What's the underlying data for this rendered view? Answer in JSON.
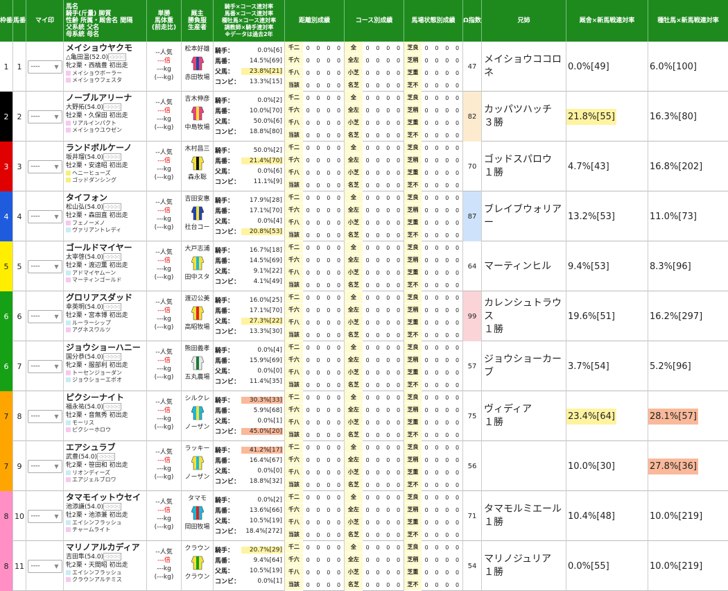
{
  "headers": {
    "waku": "枠番",
    "umaban": "馬番",
    "mark": "マイ印",
    "horse": [
      "馬名",
      "騎手(斤量) 脚質",
      "性齢 所属・厩舎名 間隔",
      "父系統 父名",
      "母系統 母名"
    ],
    "odds": [
      "単勝",
      "馬体重",
      "(前走比)"
    ],
    "owner": [
      "厩主",
      "勝負服",
      "生産者"
    ],
    "stats": [
      "騎手×コース連対率",
      "馬番×コース連対率",
      "種牡馬×コース連対率",
      "調教師×騎手連対率",
      "※データは過去2年"
    ],
    "dist": "距離別成績",
    "course": "コース別成績",
    "baba": "馬場状態別成績",
    "omega": "Ω指数",
    "sibling": "兄姉",
    "kyusha": "厩舎×新馬戦連対率",
    "sire": "種牡馬×新馬戦連対率"
  },
  "labels": {
    "stats": [
      "騎手：",
      "馬番：",
      "父馬：",
      "コンビ："
    ],
    "dist": [
      "千二",
      "千六",
      "千八",
      "当該"
    ],
    "course": [
      "全",
      "全左",
      "小芝",
      "名芝"
    ],
    "baba": [
      "芝良",
      "芝稍",
      "芝重",
      "芝不"
    ],
    "zero": "0",
    "mark_default": "----",
    "ninki": "--人気",
    "bai": "---倍",
    "kg": "---kg",
    "kg2": "(---kg)"
  },
  "colors": {
    "header": "#1e8a1e",
    "yellow": "#fff3a0",
    "orange": "#f9b99a",
    "blue": "#cfe2fb",
    "pink": "#fbd4d8",
    "peach": "#fdebd0"
  },
  "horses": [
    {
      "waku": "1",
      "wakuColor": "#ffffff",
      "wakuText": "#222",
      "umaban": "1",
      "name": "メイショウヤクモ",
      "jockey": "△亀田温(52.0)",
      "info": "牝2栗・西橋豊 初出走",
      "sire": "メイショウボーラー",
      "dam": "メイショウフェスタ",
      "sireColor": "#f6c8f0",
      "damColor": "#f6c8f0",
      "owner": "松本好雄",
      "breeder": "赤田牧場",
      "silk": [
        "#e8437a",
        "#1a49a8"
      ],
      "stats": [
        "0.0%[6]",
        "14.5%[69]",
        "23.8%[21]",
        "13.3%[15]"
      ],
      "hl": [
        null,
        null,
        "yellow",
        null
      ],
      "omega": "47",
      "omegaBg": null,
      "sibling": "メイショウココロネ",
      "sibWins": "",
      "kyusha": "0.0%[49]",
      "kyushaHl": null,
      "sireRate": "6.0%[100]",
      "sireHl": null
    },
    {
      "waku": "2",
      "wakuColor": "#000000",
      "wakuText": "#fff",
      "umaban": "2",
      "name": "ノーブルアリーナ",
      "jockey": "大野拓(54.0)",
      "info": "牡2栗・久保田 初出走",
      "sire": "リアルインパクト",
      "dam": "メイショウユウゼン",
      "sireColor": "#f6c8f0",
      "damColor": "#f6c8f0",
      "owner": "吉木伸彦",
      "breeder": "中島牧場",
      "silk": [
        "#e8437a",
        "#f3e23a"
      ],
      "stats": [
        "0.0%[2]",
        "10.0%[70]",
        "50.0%[6]",
        "18.8%[80]"
      ],
      "hl": [
        null,
        null,
        null,
        null
      ],
      "omega": "82",
      "omegaBg": "peach",
      "sibling": "カッパツハッチ",
      "sibWins": "３勝",
      "kyusha": "21.8%[55]",
      "kyushaHl": "yellow",
      "sireRate": "16.3%[80]",
      "sireHl": null
    },
    {
      "waku": "3",
      "wakuColor": "#e00000",
      "wakuText": "#fff",
      "umaban": "3",
      "name": "ランドボルケーノ",
      "jockey": "坂井瑠(54.0)",
      "info": "牡2栗・安達昭 初出走",
      "sire": "ヘニーヒューズ",
      "dam": "ゴッドダンシング",
      "sireColor": "#f6f07a",
      "damColor": "#f6f07a",
      "owner": "木村昌三",
      "breeder": "森永聡",
      "silk": [
        "#f3e23a",
        "#111111"
      ],
      "stats": [
        "50.0%[2]",
        "21.4%[70]",
        "0.0%[6]",
        "11.1%[9]"
      ],
      "hl": [
        null,
        "yellow",
        null,
        null
      ],
      "omega": "70",
      "omegaBg": null,
      "sibling": "ゴッドスパロウ",
      "sibWins": "１勝",
      "kyusha": "4.7%[43]",
      "kyushaHl": null,
      "sireRate": "16.8%[202]",
      "sireHl": null
    },
    {
      "waku": "4",
      "wakuColor": "#1f5cdd",
      "wakuText": "#fff",
      "umaban": "4",
      "name": "タイフォン",
      "jockey": "松山弘(54.0)",
      "info": "牡2栗・森田直 初出走",
      "sire": "フェノーメノ",
      "dam": "ヴァリアントレディ",
      "sireColor": "#f6c8f0",
      "damColor": "#c8ecf6",
      "owner": "吉田安惠",
      "breeder": "社台コー",
      "silk": [
        "#2244aa",
        "#f3e23a"
      ],
      "stats": [
        "17.9%[28]",
        "17.1%[70]",
        "0.0%[4]",
        "20.8%[53]"
      ],
      "hl": [
        null,
        null,
        null,
        "yellow"
      ],
      "omega": "87",
      "omegaBg": "blue",
      "sibling": "ブレイブウォリアー",
      "sibWins": "",
      "kyusha": "13.2%[53]",
      "kyushaHl": null,
      "sireRate": "11.0%[73]",
      "sireHl": null
    },
    {
      "waku": "5",
      "wakuColor": "#ffee00",
      "wakuText": "#222",
      "umaban": "5",
      "name": "ゴールドマイヤー",
      "jockey": "太宰啓(54.0)",
      "info": "牡2栗・渡辺薫 初出走",
      "sire": "アドマイヤムーン",
      "dam": "マーティンゴールド",
      "sireColor": "#c8ecf6",
      "damColor": "#f6c8f0",
      "owner": "大戸志浦",
      "breeder": "田中スタ",
      "silk": [
        "#f3e23a",
        "#1bb8d8"
      ],
      "stats": [
        "16.7%[18]",
        "14.5%[69]",
        "9.1%[22]",
        "4.1%[49]"
      ],
      "hl": [
        null,
        null,
        null,
        null
      ],
      "omega": "64",
      "omegaBg": null,
      "sibling": "マーティンヒル",
      "sibWins": "",
      "kyusha": "9.4%[53]",
      "kyushaHl": null,
      "sireRate": "8.3%[96]",
      "sireHl": null
    },
    {
      "waku": "6",
      "wakuColor": "#16a016",
      "wakuText": "#fff",
      "umaban": "6",
      "name": "グロリアスダッド",
      "jockey": "幸英明(54.0)",
      "info": "牡2栗・宮本博 初出走",
      "sire": "ルーラーシップ",
      "dam": "アグネスワルツ",
      "sireColor": "#c8ecf6",
      "damColor": "#f6c8f0",
      "owner": "渡辺公美",
      "breeder": "高昭牧場",
      "silk": [
        "#f3e23a",
        "#e02020"
      ],
      "stats": [
        "16.0%[25]",
        "17.1%[70]",
        "27.3%[22]",
        "13.3%[30]"
      ],
      "hl": [
        null,
        null,
        "yellow",
        null
      ],
      "omega": "99",
      "omegaBg": "pink",
      "sibling": "カレンシュトラウス",
      "sibWins": "１勝",
      "kyusha": "19.6%[51]",
      "kyushaHl": null,
      "sireRate": "16.2%[297]",
      "sireHl": null
    },
    {
      "waku": "6",
      "wakuColor": "#16a016",
      "wakuText": "#fff",
      "umaban": "7",
      "name": "ジョウショーハニー",
      "jockey": "国分恭(54.0)",
      "info": "牝2栗・服部利 初出走",
      "sire": "トーセンジョーダン",
      "dam": "ジョウショーエボオ",
      "sireColor": "#f6c8f0",
      "damColor": "#c8ecf6",
      "owner": "熊田義孝",
      "breeder": "五丸農場",
      "silk": [
        "#e8e8e8",
        "#1b7a3a"
      ],
      "stats": [
        "0.0%[4]",
        "15.9%[69]",
        "0.0%[0]",
        "11.4%[35]"
      ],
      "hl": [
        null,
        null,
        null,
        null
      ],
      "omega": "57",
      "omegaBg": null,
      "sibling": "ジョウショーカーブ",
      "sibWins": "",
      "kyusha": "3.7%[54]",
      "kyushaHl": null,
      "sireRate": "5.2%[96]",
      "sireHl": null
    },
    {
      "waku": "7",
      "wakuColor": "#ffa500",
      "wakuText": "#222",
      "umaban": "8",
      "name": "ピクシーナイト",
      "jockey": "福永祐(54.0)",
      "info": "牡2栗・音無秀 初出走",
      "sire": "モーリス",
      "dam": "ピクシーホロウ",
      "sireColor": "#c8ecf6",
      "damColor": "#f6c8f0",
      "owner": "シルクレ",
      "breeder": "ノーザン",
      "silk": [
        "#1bb8d8",
        "#f3e23a"
      ],
      "stats": [
        "30.3%[33]",
        "5.9%[68]",
        "0.0%[1]",
        "45.0%[20]"
      ],
      "hl": [
        "orange",
        null,
        null,
        "orange"
      ],
      "omega": "75",
      "omegaBg": null,
      "sibling": "ヴィディア",
      "sibWins": "１勝",
      "kyusha": "23.4%[64]",
      "kyushaHl": "yellow",
      "sireRate": "28.1%[57]",
      "sireHl": "orange"
    },
    {
      "waku": "7",
      "wakuColor": "#ffa500",
      "wakuText": "#222",
      "umaban": "9",
      "name": "エアシュラブ",
      "jockey": "武豊(54.0)",
      "info": "牝2栗・笹田和 初出走",
      "sire": "リオンディーズ",
      "dam": "エアジェルブロワ",
      "sireColor": "#c8ecf6",
      "damColor": "#f6c8f0",
      "owner": "ラッキー",
      "breeder": "ノーザン",
      "silk": [
        "#f3e23a",
        "#1bb8d8"
      ],
      "stats": [
        "41.2%[17]",
        "16.4%[67]",
        "0.0%[0]",
        "18.8%[32]"
      ],
      "hl": [
        "orange",
        null,
        null,
        null
      ],
      "omega": "56",
      "omegaBg": null,
      "sibling": "",
      "sibWins": "",
      "kyusha": "10.0%[30]",
      "kyushaHl": null,
      "sireRate": "27.8%[36]",
      "sireHl": "orange"
    },
    {
      "waku": "8",
      "wakuColor": "#ff8fc4",
      "wakuText": "#222",
      "umaban": "10",
      "name": "タマモイットウセイ",
      "jockey": "池添謙(54.0)",
      "info": "牡2栗・池添兼 初出走",
      "sire": "エイシンフラッシュ",
      "dam": "チャームライト",
      "sireColor": "#c8ecf6",
      "damColor": "#f6c8f0",
      "owner": "タマモ",
      "breeder": "岡田牧場",
      "silk": [
        "#1bb8d8",
        "#e02020"
      ],
      "stats": [
        "0.0%[2]",
        "13.6%[66]",
        "10.5%[19]",
        "18.4%[272]"
      ],
      "hl": [
        null,
        null,
        null,
        null
      ],
      "omega": "71",
      "omegaBg": null,
      "sibling": "タマモルミエール",
      "sibWins": "１勝",
      "kyusha": "10.4%[48]",
      "kyushaHl": null,
      "sireRate": "10.0%[219]",
      "sireHl": null
    },
    {
      "waku": "8",
      "wakuColor": "#ff8fc4",
      "wakuText": "#222",
      "umaban": "11",
      "name": "マリノアルカディア",
      "jockey": "吉田隼(54.0)",
      "info": "牝2栗・天間昭 初出走",
      "sire": "エイシンフラッシュ",
      "dam": "クラウンアルテミス",
      "sireColor": "#c8ecf6",
      "damColor": "#f6c8f0",
      "owner": "クラウン",
      "breeder": "クラウン",
      "silk": [
        "#f3e23a",
        "#16a016"
      ],
      "stats": [
        "20.7%[29]",
        "9.4%[64]",
        "10.5%[19]",
        "0.0%[1]"
      ],
      "hl": [
        "yellow",
        null,
        null,
        null
      ],
      "omega": "54",
      "omegaBg": null,
      "sibling": "マリノジュリア",
      "sibWins": "１勝",
      "kyusha": "0.0%[55]",
      "kyushaHl": null,
      "sireRate": "10.0%[219]",
      "sireHl": null
    }
  ]
}
